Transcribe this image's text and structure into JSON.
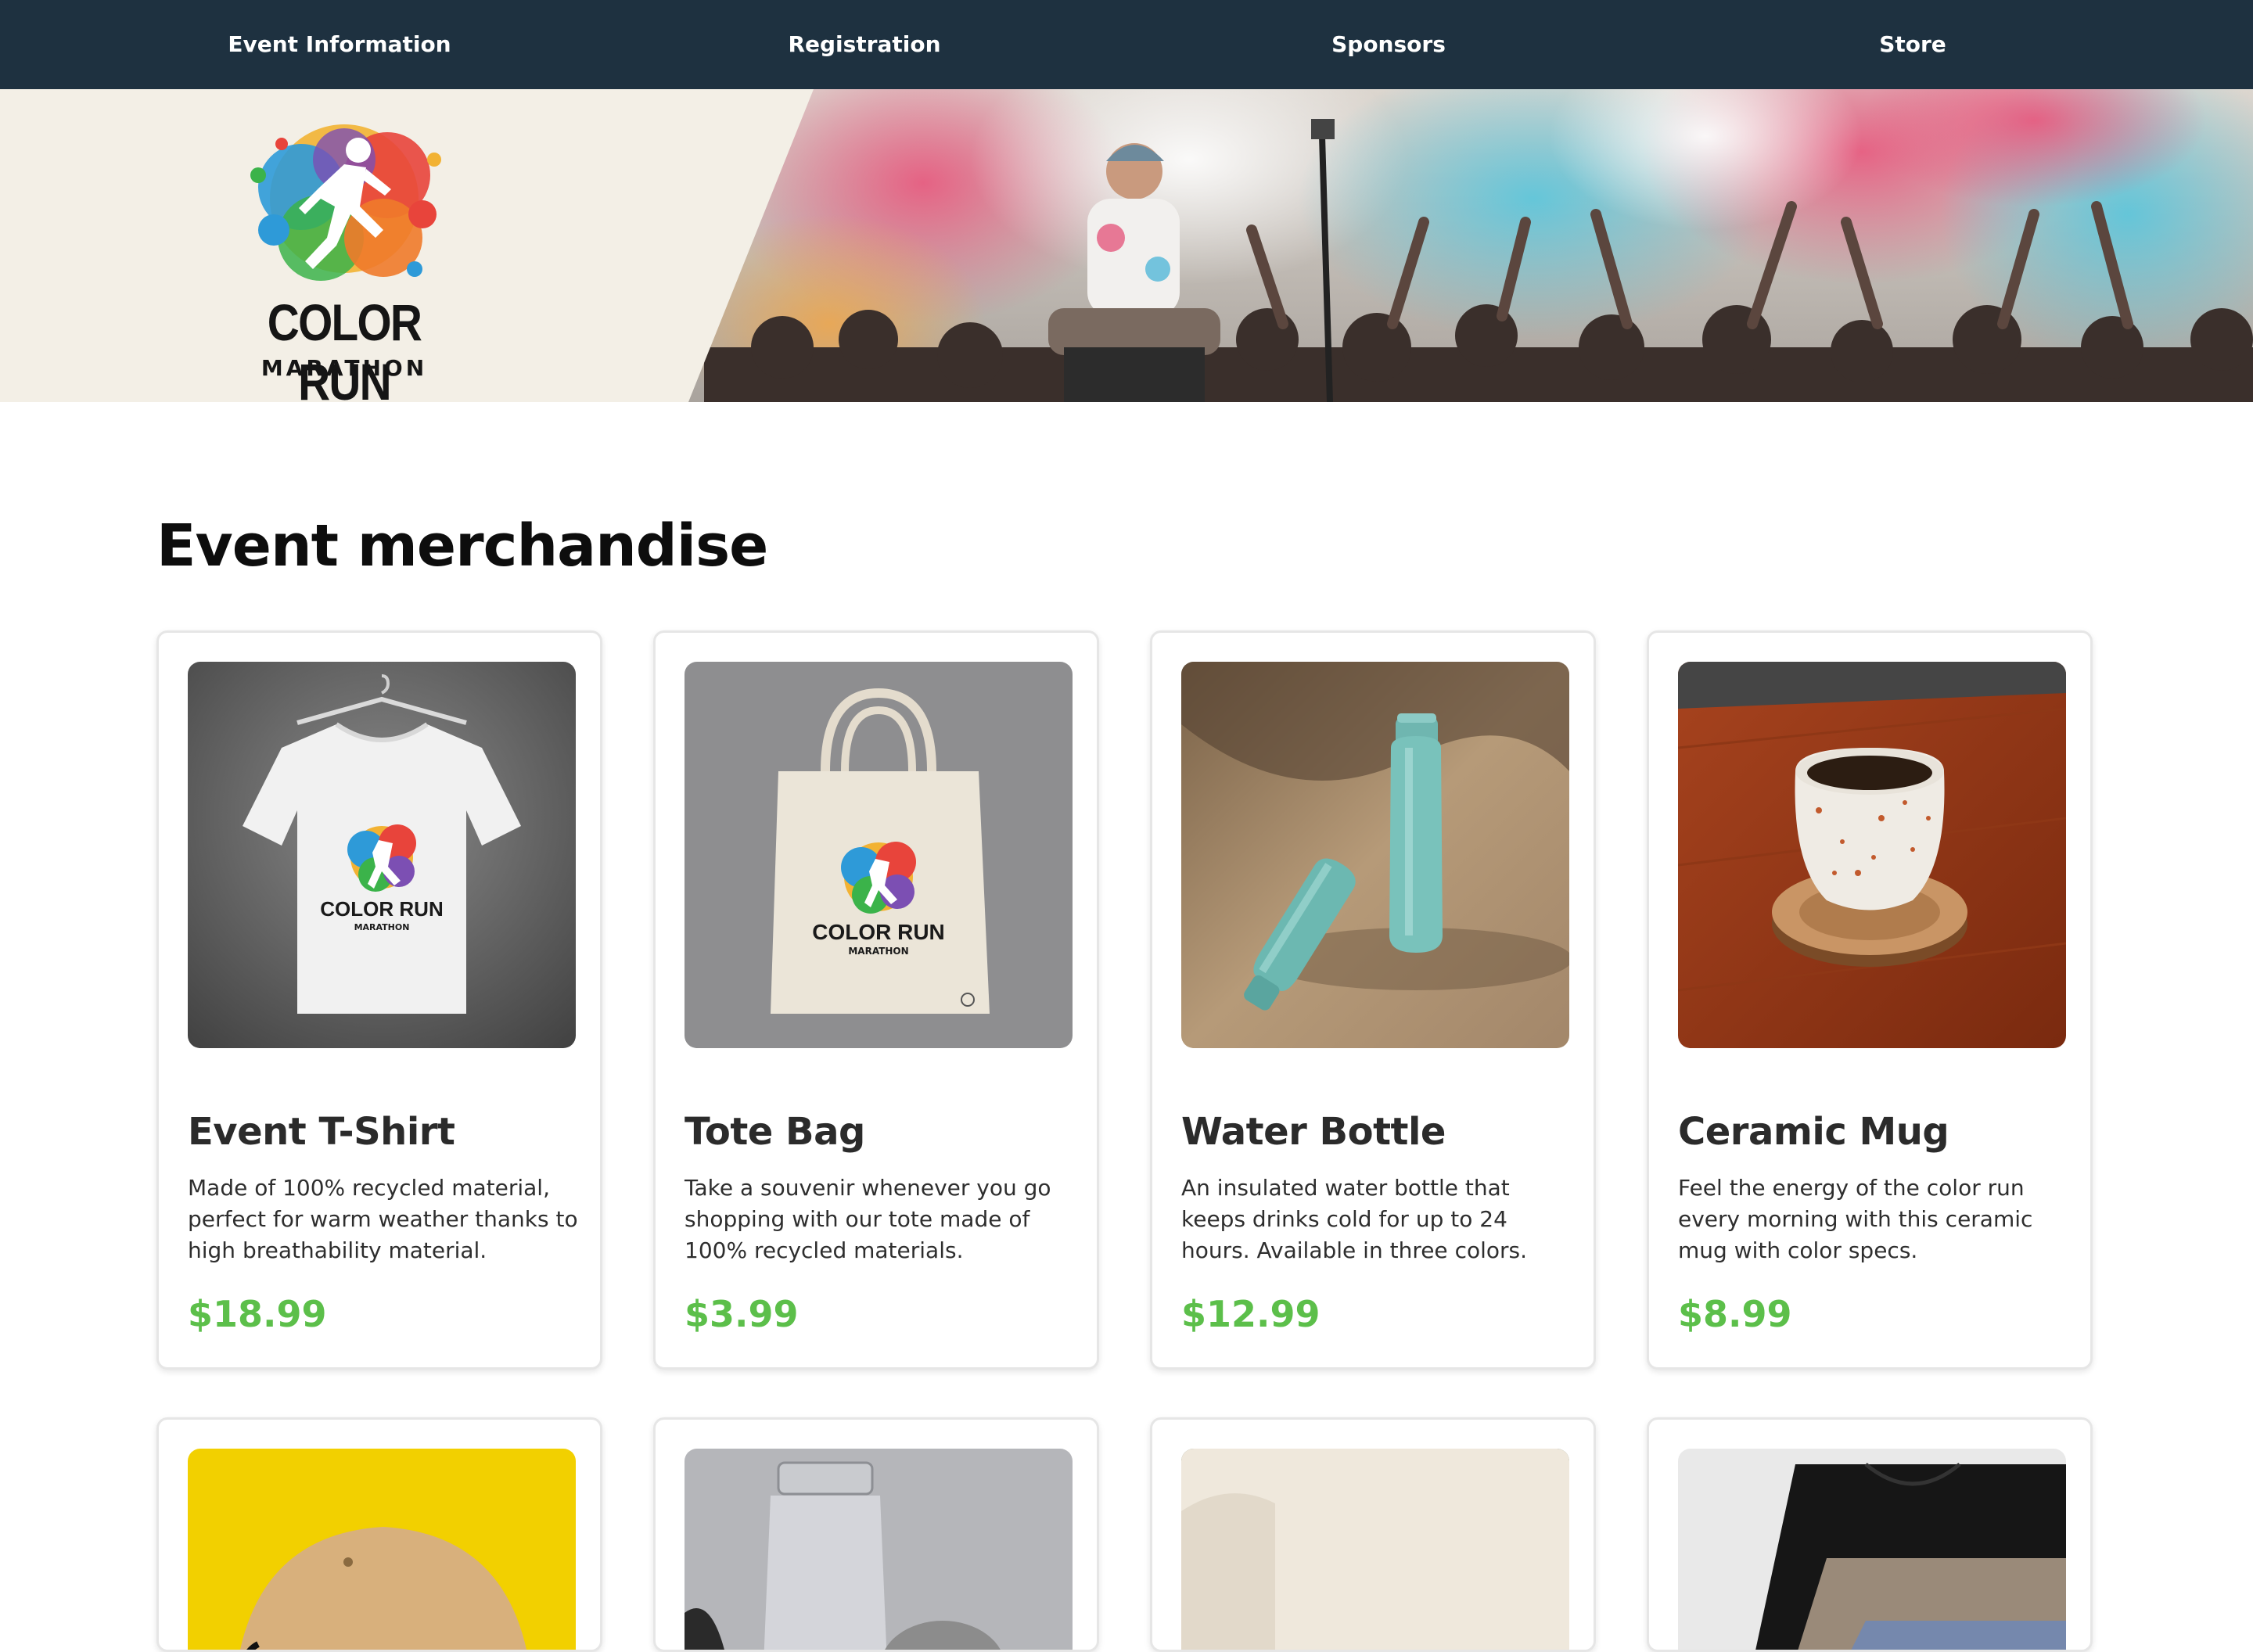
{
  "nav": {
    "items": [
      {
        "label": "Event Information"
      },
      {
        "label": "Registration"
      },
      {
        "label": "Sponsors"
      },
      {
        "label": "Store"
      }
    ]
  },
  "hero": {
    "logo_title": "COLOR RUN",
    "logo_subtitle": "MARATHON"
  },
  "store": {
    "title": "Event merchandise",
    "price_color": "#5cbf4a",
    "products": [
      {
        "name": "Event T-Shirt",
        "description": "Made of 100% recycled material, perfect for warm weather thanks to high breathability material.",
        "price": "$18.99"
      },
      {
        "name": "Tote Bag",
        "description": "Take a souvenir whenever you go shopping with our tote made of 100% recycled materials.",
        "price": "$3.99"
      },
      {
        "name": "Water Bottle",
        "description": "An insulated water bottle that keeps drinks cold for up to 24 hours. Available in three colors.",
        "price": "$12.99"
      },
      {
        "name": "Ceramic Mug",
        "description": "Feel the energy of the color run every morning with this ceramic mug with color specs.",
        "price": "$8.99"
      }
    ]
  },
  "colors": {
    "nav_bg": "#1e3140",
    "hero_bg": "#f3efe6"
  }
}
